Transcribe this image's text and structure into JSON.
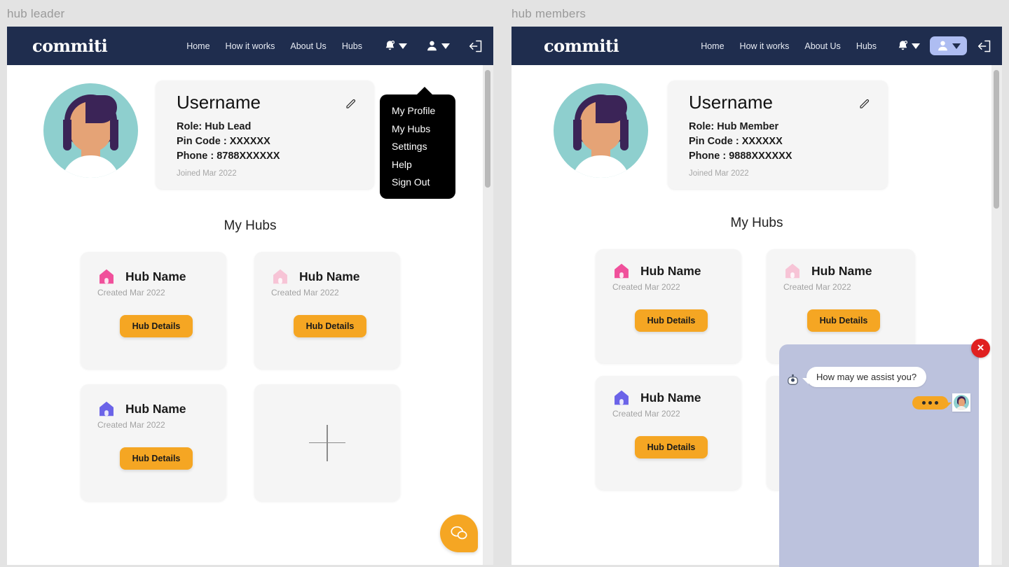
{
  "captions": {
    "left": "hub leader",
    "right": "hub members"
  },
  "colors": {
    "navy": "#1f2d4e",
    "orange": "#f5a623",
    "pink": "#f0509b",
    "pink_light": "#f7c4d6",
    "blue": "#6b63e8",
    "teal": "#8ecfce",
    "chat_panel": "#bcc2dd",
    "close_red": "#e02020"
  },
  "navbar": {
    "brand": "commiti",
    "links": [
      "Home",
      "How it works",
      "About Us",
      "Hubs"
    ],
    "icons": [
      {
        "name": "notifications-bell-icon",
        "label": "Notifications"
      },
      {
        "name": "profile-person-icon",
        "label": "Profile"
      },
      {
        "name": "logout-icon",
        "label": "Log out"
      }
    ]
  },
  "dropdown": {
    "items": [
      "My Profile",
      "My Hubs",
      "Settings",
      "Help",
      "Sign Out"
    ]
  },
  "left_panel": {
    "profile": {
      "name": "Username",
      "role": "Role: Hub Lead",
      "pin": "Pin Code : XXXXXX",
      "phone": "Phone : 8788XXXXXX",
      "joined": "Joined Mar 2022",
      "edit_icon": "pencil-edit-icon"
    },
    "section_title": "My Hubs",
    "hubs": [
      {
        "name": "Hub Name",
        "created": "Created Mar 2022",
        "button": "Hub Details",
        "icon_color": "#f0509b"
      },
      {
        "name": "Hub Name",
        "created": "Created Mar 2022",
        "button": "Hub Details",
        "icon_color": "#f7c4d6"
      },
      {
        "name": "Hub Name",
        "created": "Created Mar 2022",
        "button": "Hub Details",
        "icon_color": "#6b63e8"
      }
    ],
    "add_hub_label": "+",
    "chat_fab": "chat-bubbles-icon"
  },
  "right_panel": {
    "profile": {
      "name": "Username",
      "role": "Role: Hub Member",
      "pin": "Pin Code : XXXXXX",
      "phone": "Phone : 9888XXXXXX",
      "joined": "Joined Mar 2022",
      "edit_icon": "pencil-edit-icon"
    },
    "section_title": "My Hubs",
    "hubs": [
      {
        "name": "Hub Name",
        "created": "Created Mar 2022",
        "button": "Hub Details",
        "icon_color": "#f0509b"
      },
      {
        "name": "Hub Name",
        "created": "Created Mar 2022",
        "button": "Hub Details",
        "icon_color": "#f7c4d6"
      },
      {
        "name": "Hub Name",
        "created": "Created Mar 2022",
        "button": "Hub Details",
        "icon_color": "#6b63e8"
      }
    ],
    "add_hub_label": "+",
    "chat": {
      "bot_message": "How may we assist you?",
      "user_message": "...",
      "close_label": "×"
    }
  }
}
